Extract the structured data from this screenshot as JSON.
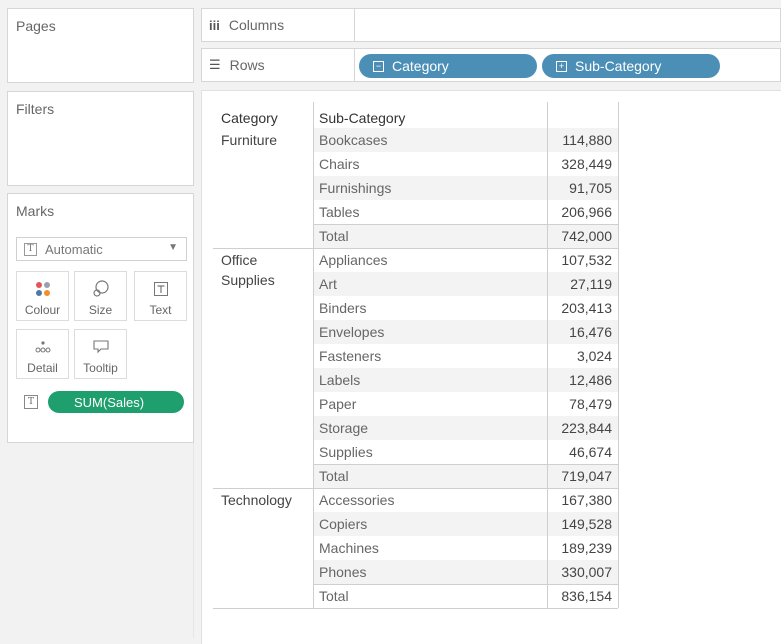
{
  "cards": {
    "pages": "Pages",
    "filters": "Filters",
    "marks": "Marks"
  },
  "marks": {
    "type": "Automatic",
    "buttons": {
      "colour": "Colour",
      "size": "Size",
      "text": "Text",
      "detail": "Detail",
      "tooltip": "Tooltip"
    },
    "pill": "SUM(Sales)"
  },
  "shelves": {
    "columns": "Columns",
    "rows": "Rows",
    "row_pills": [
      "Category",
      "Sub-Category"
    ]
  },
  "crosstab": {
    "headers": [
      "Category",
      "Sub-Category"
    ],
    "groups": [
      {
        "category": "Furniture",
        "rows": [
          {
            "sub": "Bookcases",
            "value": "114,880"
          },
          {
            "sub": "Chairs",
            "value": "328,449"
          },
          {
            "sub": "Furnishings",
            "value": "91,705"
          },
          {
            "sub": "Tables",
            "value": "206,966"
          },
          {
            "sub": "Total",
            "value": "742,000"
          }
        ]
      },
      {
        "category": "Office Supplies",
        "rows": [
          {
            "sub": "Appliances",
            "value": "107,532"
          },
          {
            "sub": "Art",
            "value": "27,119"
          },
          {
            "sub": "Binders",
            "value": "203,413"
          },
          {
            "sub": "Envelopes",
            "value": "16,476"
          },
          {
            "sub": "Fasteners",
            "value": "3,024"
          },
          {
            "sub": "Labels",
            "value": "12,486"
          },
          {
            "sub": "Paper",
            "value": "78,479"
          },
          {
            "sub": "Storage",
            "value": "223,844"
          },
          {
            "sub": "Supplies",
            "value": "46,674"
          },
          {
            "sub": "Total",
            "value": "719,047"
          }
        ]
      },
      {
        "category": "Technology",
        "rows": [
          {
            "sub": "Accessories",
            "value": "167,380"
          },
          {
            "sub": "Copiers",
            "value": "149,528"
          },
          {
            "sub": "Machines",
            "value": "189,239"
          },
          {
            "sub": "Phones",
            "value": "330,007"
          },
          {
            "sub": "Total",
            "value": "836,154"
          }
        ]
      }
    ]
  }
}
